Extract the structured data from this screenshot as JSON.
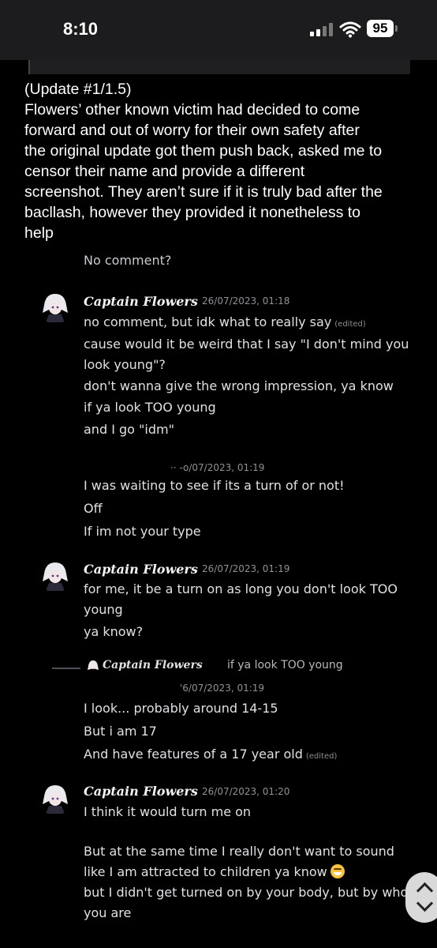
{
  "status_bar": {
    "time": "8:10",
    "battery": "95"
  },
  "post": {
    "lines": [
      "(Update #1/1.5)",
      "Flowers’ other known victim had decided to come",
      "forward and out of worry for their own safety after",
      "the original update got them push back, asked me to",
      "censor their name and provide a different",
      "screenshot. They aren’t sure if it is truly bad after the",
      "bacllash, however they provided it nonetheless to",
      "help"
    ]
  },
  "chat": {
    "partial_top": "No comment?",
    "messages": [
      {
        "author": "Captain Flowers",
        "timestamp": "26/07/2023, 01:18",
        "lines": [
          "no comment, but idk what to really say",
          "cause would it be weird that I say \"I don't mind you",
          "look young\"?",
          "don't wanna give the wrong impression, ya know",
          "if ya look TOO young",
          "and I go \"idm\""
        ],
        "edited_label": "(edited)"
      },
      {
        "author": "",
        "timestamp": "·· -o/07/2023, 01:19",
        "lines": [
          "I was waiting to see if its a turn of or not!",
          "Off",
          "If im not your type"
        ]
      },
      {
        "author": "Captain Flowers",
        "timestamp": "26/07/2023, 01:19",
        "lines": [
          "for me, it be a turn on as long you don't look TOO",
          "young",
          "ya know?"
        ]
      },
      {
        "reply_author": "Captain Flowers",
        "reply_text": "if ya look TOO young",
        "timestamp": "'6/07/2023, 01:19",
        "lines": [
          "I look... probably around 14-15",
          "But i am 17",
          "And have features of a 17 year old"
        ],
        "edited_label": "(edited)"
      },
      {
        "author": "Captain Flowers",
        "timestamp": "26/07/2023, 01:20",
        "lines": [
          "I think it would turn me on",
          "But at the same time I really don't want to sound",
          "like I am attracted to children ya know",
          "but I didn't get turned on by your body, but by who",
          "you are"
        ]
      }
    ]
  },
  "colors": {
    "background": "#000000",
    "status_bar": "#1c1c1e",
    "chat_text": "#dfe1e4",
    "timestamp": "#8e9297"
  },
  "icons": [
    "signal-icon",
    "wifi-icon",
    "battery-icon",
    "avatar-icon",
    "emoji-sweat-smile-icon",
    "chevron-up-icon",
    "chevron-down-icon"
  ]
}
